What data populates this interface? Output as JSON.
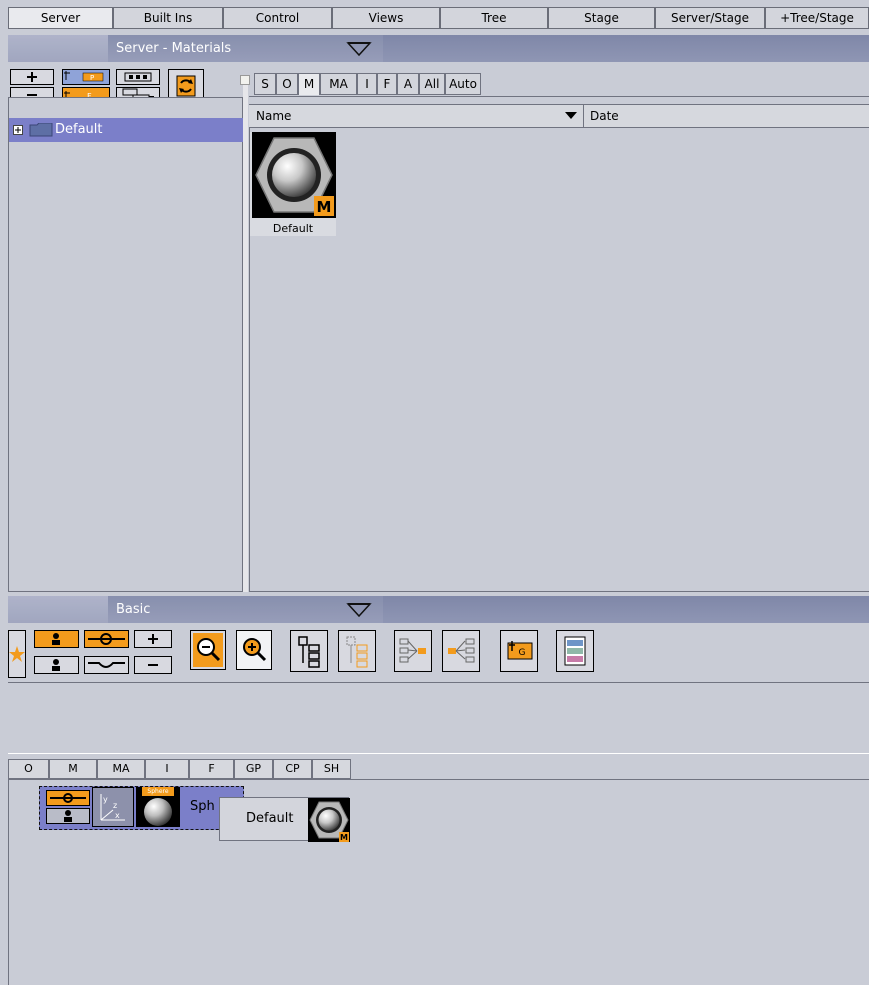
{
  "top_tabs": [
    {
      "label": "Server"
    },
    {
      "label": "Built Ins"
    },
    {
      "label": "Control"
    },
    {
      "label": "Views"
    },
    {
      "label": "Tree"
    },
    {
      "label": "Stage"
    },
    {
      "label": "Server/Stage"
    },
    {
      "label": "+Tree/Stage"
    }
  ],
  "server_panel": {
    "title": "Server - Materials",
    "tree_item": "Default",
    "material_tabs": [
      "S",
      "O",
      "M",
      "MA",
      "I",
      "F",
      "A",
      "All",
      "Auto"
    ],
    "active_tab": "M",
    "columns": {
      "name": "Name",
      "date": "Date"
    },
    "items": [
      {
        "label": "Default",
        "badge": "M"
      }
    ]
  },
  "basic_panel": {
    "title": "Basic",
    "tabs": [
      "O",
      "M",
      "MA",
      "I",
      "F",
      "GP",
      "CP",
      "SH"
    ],
    "node": {
      "label": "Sph",
      "thumb_label": "Sphere"
    },
    "drop_tooltip": {
      "label": "Default",
      "badge": "M"
    }
  },
  "colors": {
    "accent": "#f39b1c",
    "header": "#8790b0",
    "selection": "#7b7fc9",
    "background": "#c9ccd6"
  }
}
